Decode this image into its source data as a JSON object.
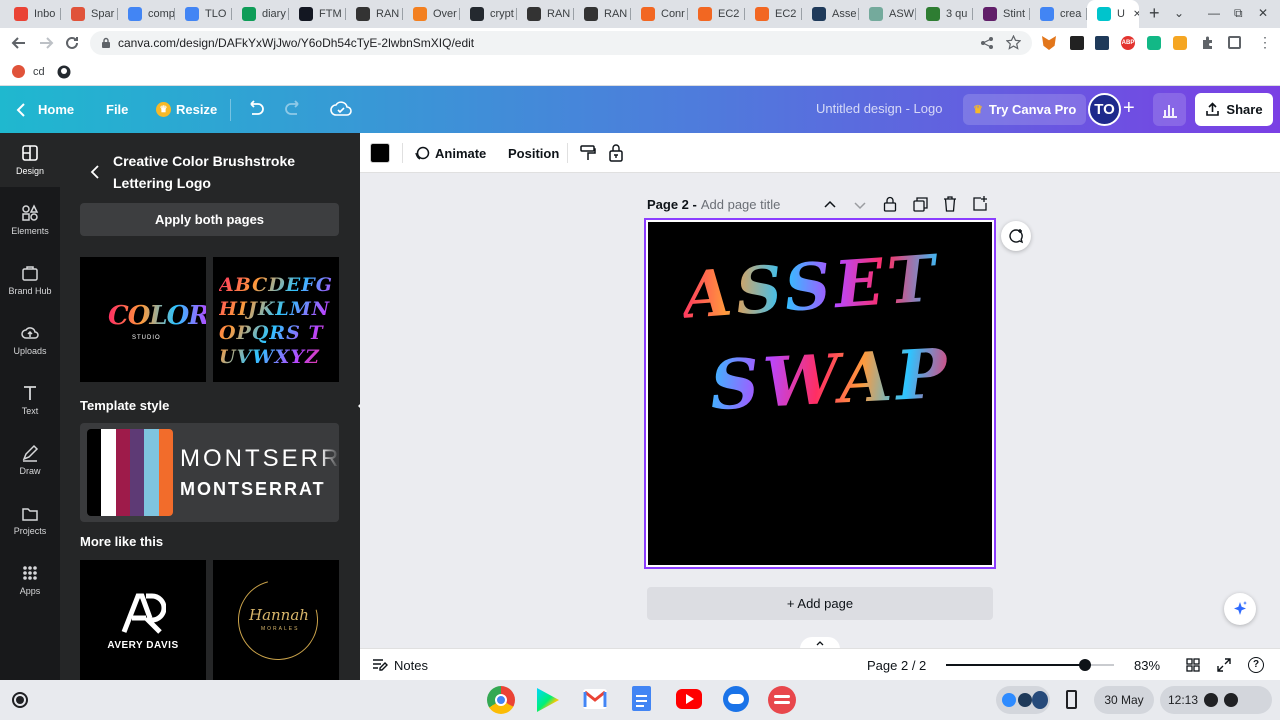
{
  "browser": {
    "tabs": [
      {
        "label": "Inbo",
        "icon": "gmail-icon",
        "color": "#ea4335"
      },
      {
        "label": "Spar",
        "icon": "s-icon",
        "color": "#e0533a"
      },
      {
        "label": "comp",
        "icon": "docs-icon",
        "color": "#4285f4"
      },
      {
        "label": "TLO",
        "icon": "docs-icon",
        "color": "#4285f4"
      },
      {
        "label": "diary",
        "icon": "sheets-icon",
        "color": "#0f9d58"
      },
      {
        "label": "FTM",
        "icon": "tradingview-icon",
        "color": "#131722"
      },
      {
        "label": "RAN",
        "icon": "r-icon",
        "color": "#333333"
      },
      {
        "label": "Over",
        "icon": "cloudflare-icon",
        "color": "#f38020"
      },
      {
        "label": "crypt",
        "icon": "github-icon",
        "color": "#24292f"
      },
      {
        "label": "RAN",
        "icon": "r-icon",
        "color": "#333333"
      },
      {
        "label": "RAN",
        "icon": "r-icon",
        "color": "#333333"
      },
      {
        "label": "Conr",
        "icon": "orange-icon",
        "color": "#f26722"
      },
      {
        "label": "EC2",
        "icon": "aws-icon",
        "color": "#f26722"
      },
      {
        "label": "EC2",
        "icon": "aws-icon",
        "color": "#f26722"
      },
      {
        "label": "Asse",
        "icon": "app-icon",
        "color": "#1f3a5a"
      },
      {
        "label": "ASW",
        "icon": "chatgpt-icon",
        "color": "#74aa9c"
      },
      {
        "label": "3 qu",
        "icon": "tree-icon",
        "color": "#2e7d32"
      },
      {
        "label": "Stint",
        "icon": "slack-icon",
        "color": "#611f69"
      },
      {
        "label": "crea",
        "icon": "search-icon",
        "color": "#4285f4"
      },
      {
        "label": "U",
        "icon": "canva-icon",
        "color": "#00c4cc",
        "active": true
      }
    ],
    "url": "canva.com/design/DAFkYxWjJwo/Y6oDh54cTyE-2lwbnSmXIQ/edit",
    "bookmarks": [
      {
        "label": "cd",
        "icon": "bookmark-icon"
      },
      {
        "label": "",
        "icon": "github-icon"
      }
    ]
  },
  "header": {
    "home_label": "Home",
    "file_label": "File",
    "resize_label": "Resize",
    "doc_title": "Untitled design - Logo",
    "try_pro_label": "Try Canva Pro",
    "avatar_initials": "TO",
    "share_label": "Share"
  },
  "rail": [
    {
      "label": "Design",
      "icon": "layout-icon",
      "active": true
    },
    {
      "label": "Elements",
      "icon": "shapes-icon"
    },
    {
      "label": "Brand Hub",
      "icon": "brand-icon"
    },
    {
      "label": "Uploads",
      "icon": "cloud-upload-icon"
    },
    {
      "label": "Text",
      "icon": "text-icon"
    },
    {
      "label": "Draw",
      "icon": "pen-icon"
    },
    {
      "label": "Projects",
      "icon": "folder-icon"
    },
    {
      "label": "Apps",
      "icon": "grid-icon"
    }
  ],
  "panel": {
    "title": "Creative Color Brushstroke Lettering Logo",
    "apply_label": "Apply both pages",
    "thumbs": [
      {
        "main": "COLOR",
        "sub": "STUDIO"
      },
      {
        "main": "ABCDEFG HIJKLMN OPQRS TUVWXYZ",
        "sub": ""
      }
    ],
    "template_style_label": "Template style",
    "palette": [
      "#000000",
      "#ffffff",
      "#9e1b4a",
      "#5e3a75",
      "#7fc4df",
      "#f26c2b"
    ],
    "font_sample_1": "MONTSERRAT",
    "font_sample_2": "MONTSERRAT",
    "more_like_label": "More like this",
    "more": [
      {
        "main": "AVERY DAVIS"
      },
      {
        "main": "Hannah",
        "sub": "MORALES"
      }
    ]
  },
  "toolbar": {
    "color_swatch": "#000000",
    "animate_label": "Animate",
    "position_label": "Position"
  },
  "page": {
    "label": "Page 2 -",
    "title_placeholder": "Add page title",
    "artwork_line1": "ASSET",
    "artwork_line2": "SWAP",
    "add_page_label": "+ Add page"
  },
  "footer": {
    "notes_label": "Notes",
    "page_counter": "Page 2 / 2",
    "zoom_level": 0.83,
    "zoom_label": "83%"
  },
  "shelf": {
    "date": "30 May",
    "time": "12:13"
  }
}
